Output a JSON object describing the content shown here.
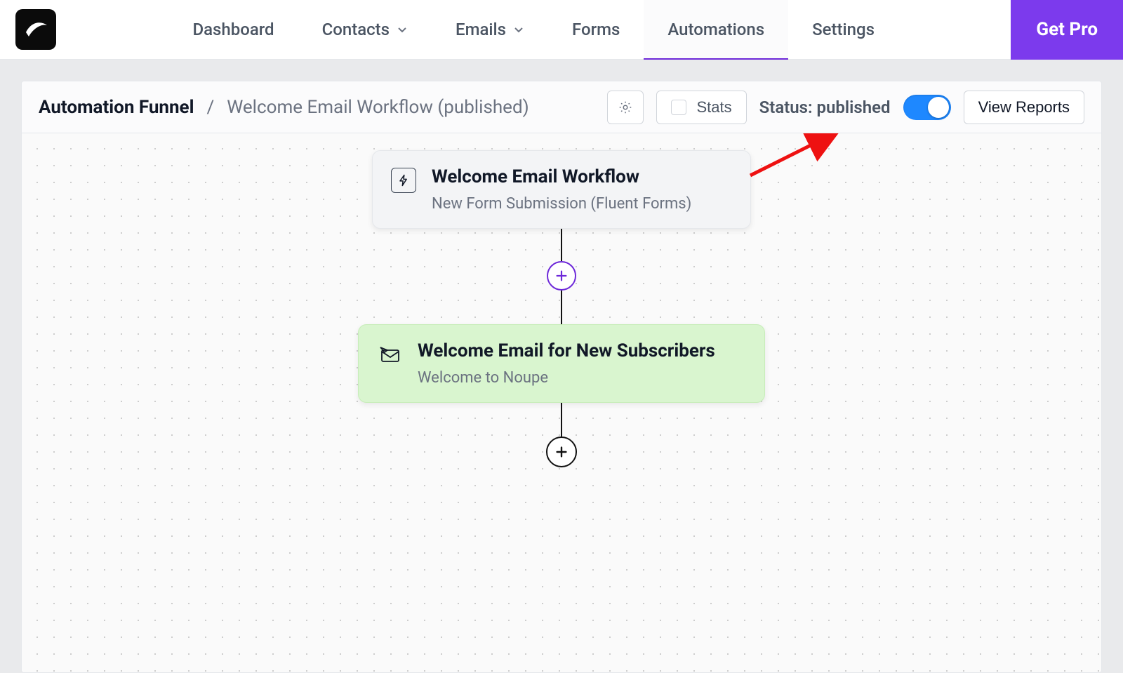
{
  "nav": {
    "items": [
      {
        "label": "Dashboard",
        "has_chevron": false
      },
      {
        "label": "Contacts",
        "has_chevron": true
      },
      {
        "label": "Emails",
        "has_chevron": true
      },
      {
        "label": "Forms",
        "has_chevron": false
      },
      {
        "label": "Automations",
        "has_chevron": false,
        "active": true
      },
      {
        "label": "Settings",
        "has_chevron": false
      }
    ],
    "get_pro": "Get Pro"
  },
  "header": {
    "breadcrumb_root": "Automation Funnel",
    "breadcrumb_sep": "/",
    "breadcrumb_current": "Welcome Email Workflow (published)",
    "stats_label": "Stats",
    "status_label": "Status: published",
    "status_toggle_on": true,
    "view_reports": "View Reports"
  },
  "flow": {
    "trigger": {
      "title": "Welcome Email Workflow",
      "subtitle": "New Form Submission (Fluent Forms)"
    },
    "action": {
      "title": "Welcome Email for New Subscribers",
      "subtitle": "Welcome to Noupe"
    }
  },
  "colors": {
    "accent_purple": "#7c3aed",
    "toggle_blue": "#1e88ff",
    "action_green": "#d9f5cf"
  }
}
